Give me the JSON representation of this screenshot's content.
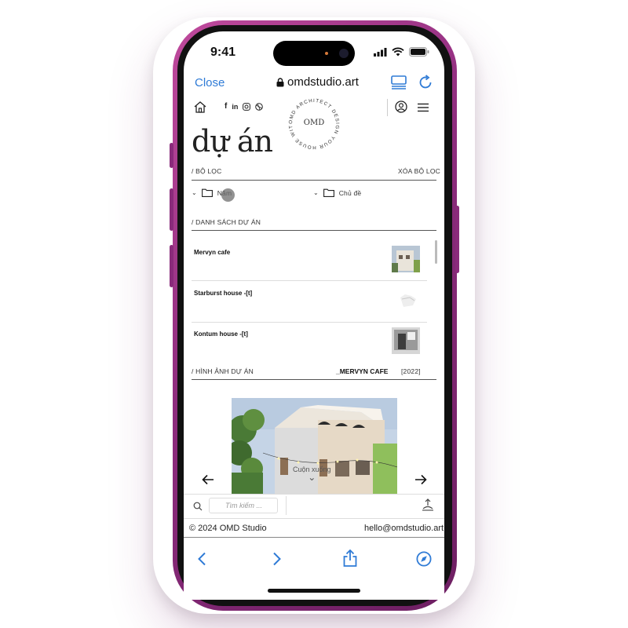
{
  "status_bar": {
    "time": "9:41"
  },
  "browser": {
    "close_label": "Close",
    "url": "omdstudio.art"
  },
  "badge": {
    "center": "OMD",
    "ring_text": "OMD ARCHITECT DESIGN YOUR HOUSE WITH"
  },
  "page": {
    "title": "dự án",
    "filter_header": "/ BỘ LỌC",
    "clear_filter": "XÓA BỘ LỌC",
    "filters": [
      {
        "label": "Năm"
      },
      {
        "label": "Chủ đề"
      }
    ],
    "project_list_header": "/ DANH SÁCH DỰ ÁN",
    "projects": [
      {
        "name": "Mervyn cafe"
      },
      {
        "name": "Starburst house -[t]"
      },
      {
        "name": "Kontum house -[t]"
      }
    ],
    "images_header": "/ HÌNH ẢNH DỰ ÁN",
    "current_project": "_MERVYN CAFE",
    "current_year": "[2022]",
    "scroll_hint": "Cuộn xuống"
  },
  "search": {
    "placeholder": "Tìm kiếm ..."
  },
  "footer": {
    "copyright": "© 2024 OMD Studio",
    "email": "hello@omdstudio.art"
  },
  "colors": {
    "phone_frame": "#8d2c7d",
    "ios_blue": "#2f7bd6"
  }
}
